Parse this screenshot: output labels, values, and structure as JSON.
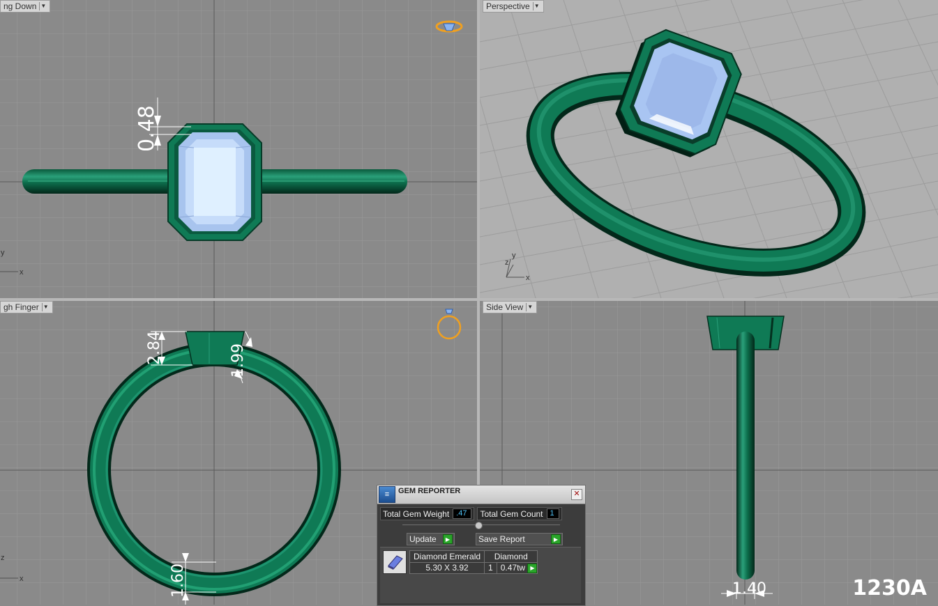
{
  "viewports": {
    "top_left_label": "ng Down",
    "top_right_label": "Perspective",
    "bottom_left_label": "gh Finger",
    "bottom_right_label": "Side View"
  },
  "dimensions": {
    "top_height": "0.48",
    "front_height": "2.84",
    "front_width": "1.99",
    "front_bottom": "1.60",
    "side_width": "1.40"
  },
  "axes": {
    "tl_y": "y",
    "tl_x": "x",
    "tr_y": "y",
    "tr_z": "z",
    "tr_x": "x",
    "bl_z": "z",
    "bl_x": "x"
  },
  "gem_reporter": {
    "title": "GEM REPORTER",
    "total_weight_label": "Total Gem Weight",
    "total_weight_value": ".47",
    "total_count_label": "Total Gem Count",
    "total_count_value": "1",
    "update_label": "Update",
    "save_label": "Save Report",
    "gem_cut": "Diamond Emerald",
    "gem_type": "Diamond",
    "gem_size": "5.30 X 3.92",
    "gem_qty": "1",
    "gem_tw": "0.47tw"
  },
  "watermark": "1230A",
  "colors": {
    "metal": "#0f7a55",
    "gem": "#bcd4f5",
    "grid_bg": "#8a8a8a"
  }
}
